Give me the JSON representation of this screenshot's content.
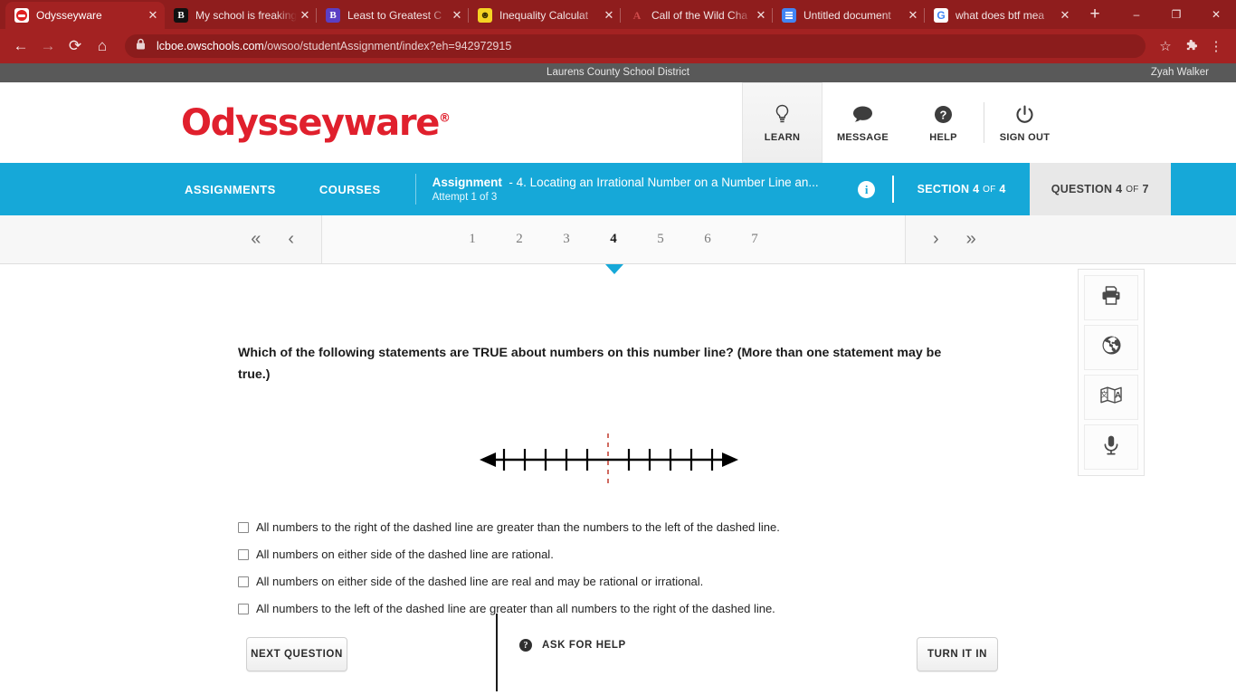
{
  "browser": {
    "tabs": [
      {
        "title": "Odysseyware",
        "favicon": "odysseyware-icon",
        "active": true
      },
      {
        "title": "My school is freaking",
        "favicon": "brainly-icon",
        "active": false
      },
      {
        "title": "Least to Greatest C",
        "favicon": "brainly-purple-icon",
        "active": false
      },
      {
        "title": "Inequality Calculat",
        "favicon": "smiley-icon",
        "active": false
      },
      {
        "title": "Call of the Wild Cha",
        "favicon": "apex-icon",
        "active": false
      },
      {
        "title": "Untitled document",
        "favicon": "google-docs-icon",
        "active": false
      },
      {
        "title": "what does btf mea",
        "favicon": "google-icon",
        "active": false
      }
    ],
    "new_tab_label": "+",
    "close_label": "✕",
    "window_controls": {
      "minimize": "–",
      "restore": "❐",
      "close": "✕"
    },
    "url_domain": "lcboe.owschools.com",
    "url_path": "/owsoo/studentAssignment/index?eh=942972915",
    "back_label": "←",
    "forward_label": "→",
    "reload_label": "⟳",
    "home_label": "⌂",
    "bookmark_label": "☆",
    "menu_label": "⋮",
    "theme_color": "#a32222"
  },
  "district_bar": {
    "district": "Laurens County School District",
    "user": "Zyah Walker"
  },
  "app_header": {
    "logo_text": "Odysseyware",
    "logo_mark": "®",
    "logo_color": "#e0202d",
    "actions": [
      {
        "label": "LEARN",
        "icon": "lightbulb-icon",
        "active": true
      },
      {
        "label": "MESSAGE",
        "icon": "chat-bubble-icon",
        "active": false
      },
      {
        "label": "HELP",
        "icon": "question-circle-icon",
        "active": false
      },
      {
        "label": "SIGN OUT",
        "icon": "power-icon",
        "active": false
      }
    ]
  },
  "nav_bar": {
    "accent_color": "#16a8d8",
    "assignments_label": "ASSIGNMENTS",
    "courses_label": "COURSES",
    "assignment_prefix": "Assignment",
    "assignment_title": "- 4. Locating an Irrational Number on a Number Line an...",
    "attempt_text": "Attempt 1 of 3",
    "info_icon_label": "i",
    "section_label": "SECTION",
    "section_current": "4",
    "section_of": "OF",
    "section_total": "4",
    "question_label": "QUESTION",
    "question_current": "4",
    "question_of": "OF",
    "question_total": "7"
  },
  "pager": {
    "first_label": "«",
    "prev_label": "‹",
    "next_label": "›",
    "last_label": "»",
    "pages": [
      "1",
      "2",
      "3",
      "4",
      "5",
      "6",
      "7"
    ],
    "current_page": "4"
  },
  "question": {
    "text": "Which of the following statements are TRUE about numbers on this number line? (More than one statement may be true.)",
    "choices": [
      {
        "label": "All numbers to the right of the dashed line are greater than the numbers to the left of the dashed line.",
        "checked": false
      },
      {
        "label": "All numbers on either side of the dashed line are rational.",
        "checked": false
      },
      {
        "label": "All numbers on either side of the dashed line are real and may be rational or irrational.",
        "checked": false
      },
      {
        "label": "All numbers to the left of the dashed line are greater than all numbers to the right of the dashed line.",
        "checked": false
      }
    ]
  },
  "chart_data": {
    "type": "number-line",
    "title": "",
    "ticks_left_of_marker": 5,
    "ticks_right_of_marker": 5,
    "total_ticks": 10,
    "tick_labels": [],
    "marker": {
      "style": "dashed",
      "color": "#c0392b",
      "position": "center"
    },
    "arrows": [
      "left",
      "right"
    ],
    "line_color": "#000000"
  },
  "bottom": {
    "next_question_label": "NEXT QUESTION",
    "ask_for_help_label": "ASK FOR HELP",
    "ask_icon_label": "?",
    "turn_it_in_label": "TURN IT IN"
  },
  "tools": [
    {
      "name": "print-icon",
      "tooltip": "Print"
    },
    {
      "name": "globe-icon",
      "tooltip": "Web"
    },
    {
      "name": "translate-icon",
      "tooltip": "Translate"
    },
    {
      "name": "microphone-icon",
      "tooltip": "Read aloud"
    }
  ]
}
